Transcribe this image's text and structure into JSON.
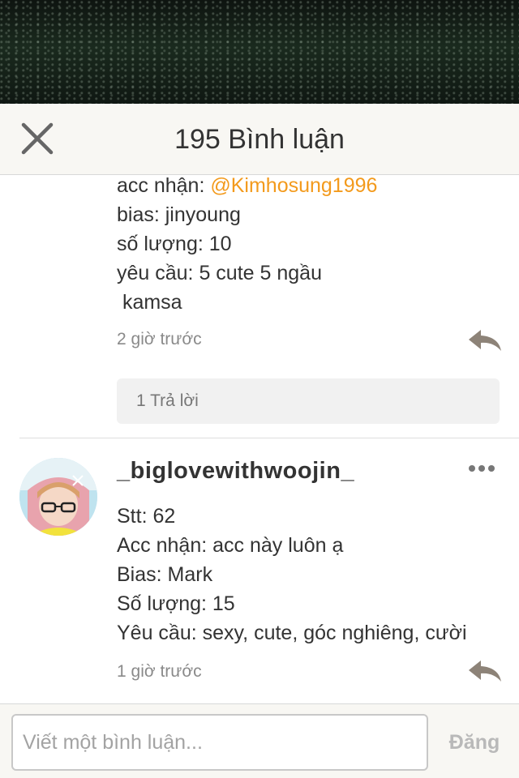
{
  "header": {
    "title": "195 Bình luận",
    "close_icon": "close-icon"
  },
  "comment1": {
    "lines": {
      "acc_prefix": "acc nhận: ",
      "acc_mention": "@Kimhosung1996",
      "bias": "bias: jinyoung",
      "qty": "số lượng: 10",
      "req": "yêu cầu: 5 cute 5 ngầu",
      "thanks": " kamsa"
    },
    "time": "2 giờ trước",
    "replies_label": "1 Trả lời",
    "reply_icon": "reply-icon"
  },
  "comment2": {
    "username": "_biglovewithwoojin_",
    "lines": {
      "stt": "Stt: 62",
      "acc": "Acc nhận: acc này luôn ạ",
      "bias": "Bias: Mark",
      "qty": "Số lượng: 15",
      "req": "Yêu cầu: sexy, cute, góc nghiêng, cười"
    },
    "time": "1 giờ trước",
    "more_icon": "more-icon",
    "reply_icon": "reply-icon"
  },
  "footer": {
    "placeholder": "Viết một bình luận...",
    "post_label": "Đăng"
  },
  "colors": {
    "mention": "#f39a1c",
    "header_bg": "#f8f7f3",
    "reply_icon": "#8d8378"
  }
}
